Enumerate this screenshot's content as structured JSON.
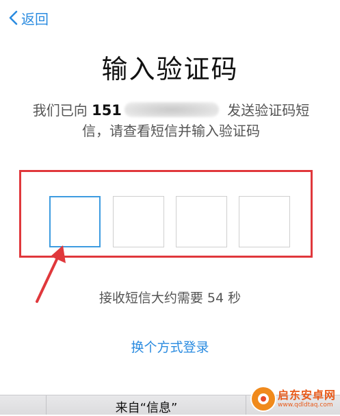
{
  "nav": {
    "back_label": "返回"
  },
  "header": {
    "title": "输入验证码"
  },
  "message": {
    "prefix": "我们已向 ",
    "phone_visible": "151",
    "suffix": " 发送验证码短信，请查看短信并输入验证码"
  },
  "code_input": {
    "length": 4,
    "values": [
      "",
      "",
      "",
      ""
    ],
    "active_index": 0
  },
  "timer": {
    "text": "接收短信大约需要 54 秒"
  },
  "actions": {
    "switch_method_label": "换个方式登录"
  },
  "keyboard_bar": {
    "suggestion": "来自“信息”"
  },
  "watermark": {
    "name": "启东安卓网",
    "url": "www.qdldtaq.com"
  },
  "colors": {
    "accent": "#2a8be0",
    "annotation_red": "#e0383c",
    "active_box_border": "#3d9be0"
  }
}
